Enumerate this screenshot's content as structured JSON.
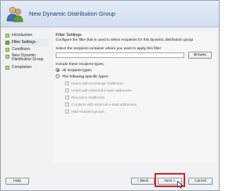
{
  "header": {
    "title": "New Dynamic Distribution Group"
  },
  "nav": {
    "items": [
      {
        "label": "Introduction",
        "active": false
      },
      {
        "label": "Filter Settings",
        "active": true
      },
      {
        "label": "Conditions",
        "active": false
      },
      {
        "label_line1": "New Dynamic",
        "label_line2": "Distribution Group",
        "active": false
      },
      {
        "label": "Completion",
        "active": false
      }
    ]
  },
  "filter": {
    "title": "Filter Settings",
    "description": "Configure the filter that is used to select recipients for this dynamic distribution group.",
    "container_label": "Select the recipient container where you want to apply this filter:",
    "container_value": "",
    "browse_label": "Browse",
    "include_label": "Include these recipient types:",
    "radio_all": "All recipient types",
    "radio_specific": "The following specific types:",
    "types": [
      "Users with Exchange mailboxes",
      "Users with external e-mail addresses",
      "Resource mailboxes",
      "Contacts with external e-mail addresses",
      "Mail-enabled groups"
    ]
  },
  "footer": {
    "help_label": "Help",
    "back_label": "< Back",
    "next_label": "Next >",
    "cancel_label": "Cancel"
  },
  "colors": {
    "title": "#1e3c70",
    "highlight": "#d0232a",
    "active_bullet": "#6fb22f"
  },
  "icons": {
    "header": "people-group-icon",
    "cursor": "mouse-pointer-icon"
  }
}
